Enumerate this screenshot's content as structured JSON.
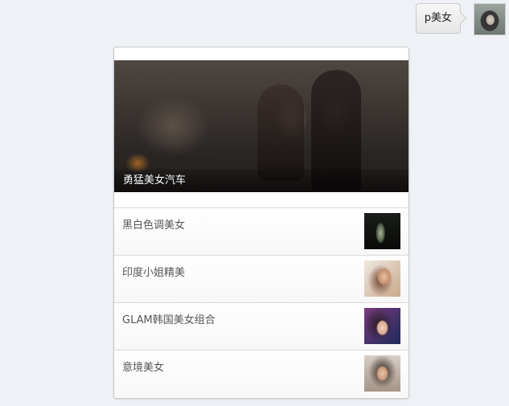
{
  "chat": {
    "outgoing_message": "p美女"
  },
  "card": {
    "headline": {
      "caption": "勇猛美女汽车"
    },
    "items": [
      {
        "title": "黑白色调美女"
      },
      {
        "title": "印度小姐精美"
      },
      {
        "title": "GLAM韩国美女组合"
      },
      {
        "title": "意境美女"
      }
    ]
  }
}
